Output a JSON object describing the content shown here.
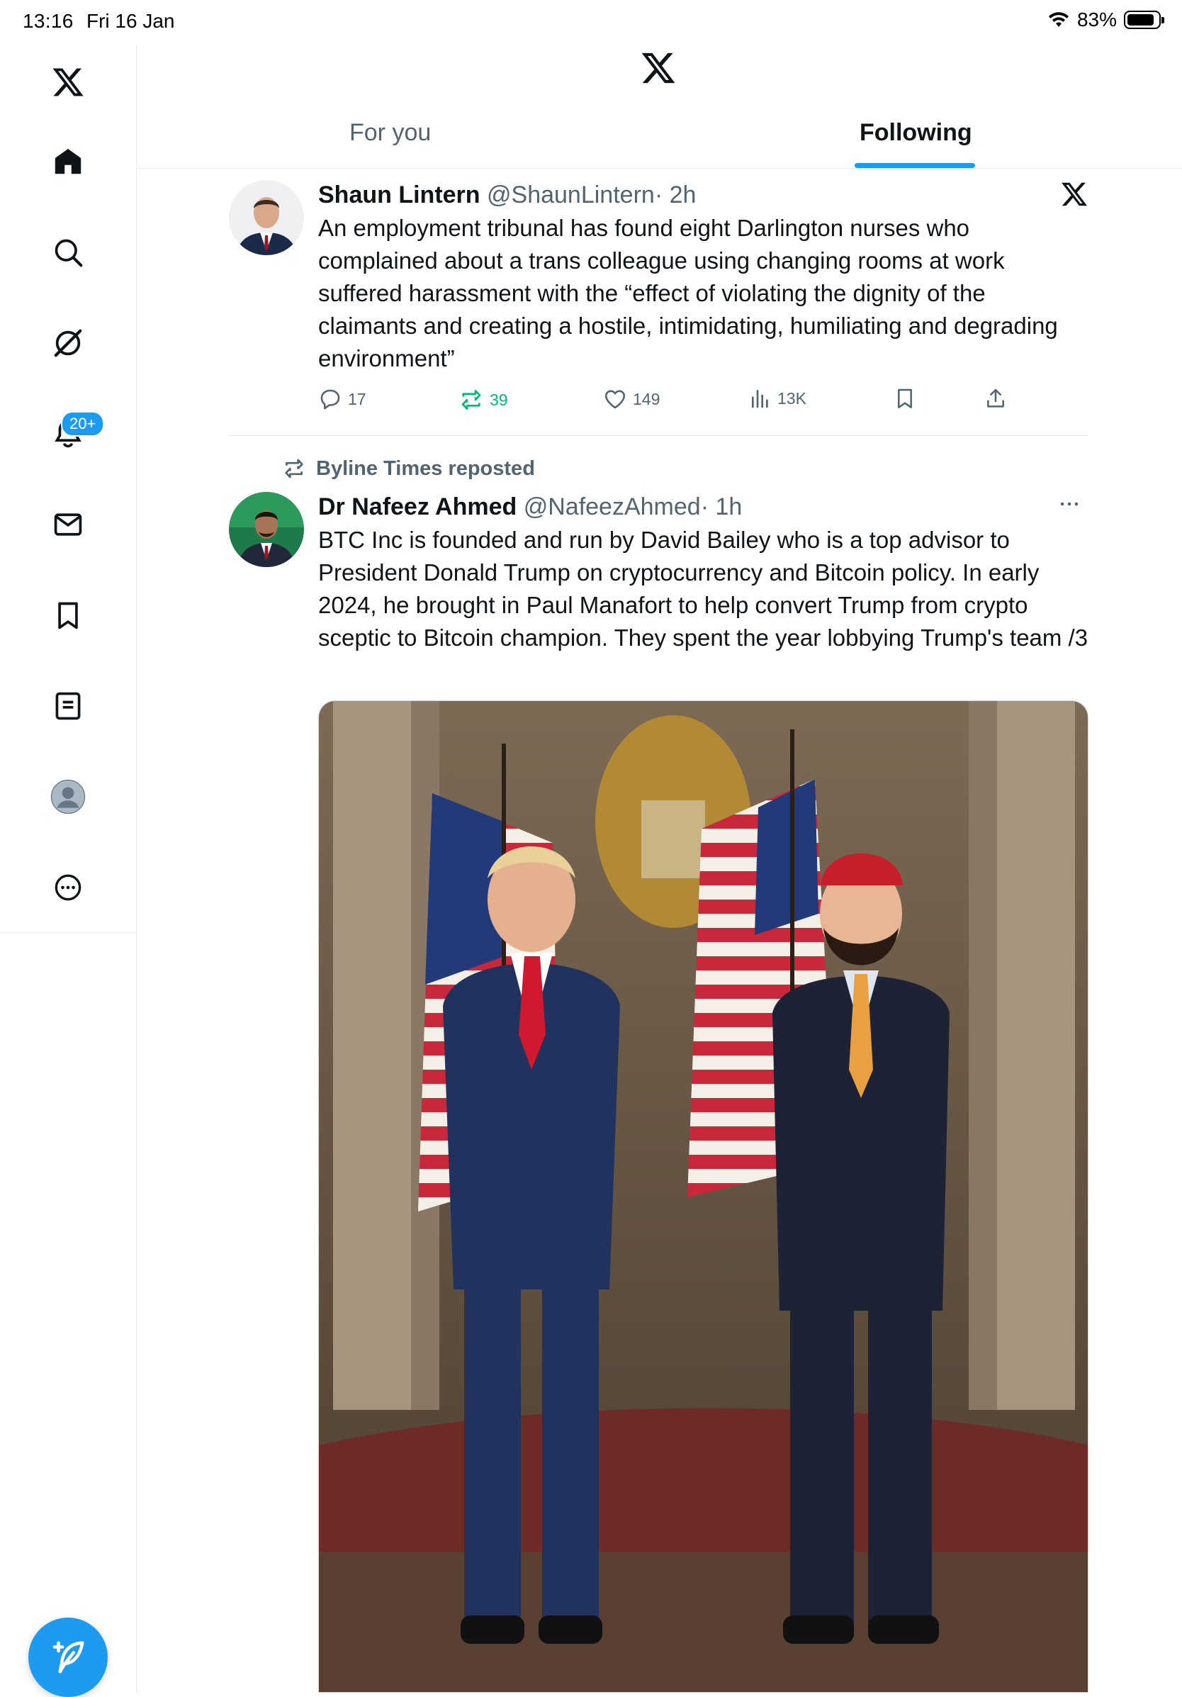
{
  "status_bar": {
    "time": "13:16",
    "date": "Fri 16 Jan",
    "battery": "83%"
  },
  "sidebar": {
    "items": [
      "home-icon",
      "search-icon",
      "grok-icon",
      "notifications-icon",
      "messages-icon",
      "bookmarks-icon",
      "lists-icon",
      "profile-icon",
      "more-icon"
    ],
    "notifications_badge": "20+"
  },
  "header": {
    "tabs": [
      {
        "label": "For you",
        "active": false
      },
      {
        "label": "Following",
        "active": true
      }
    ]
  },
  "tweets": [
    {
      "name": "Shaun Lintern",
      "handle": "@ShaunLintern",
      "time": "· 2h",
      "text": "An employment tribunal has found eight Darlington nurses who complained about a trans colleague using changing rooms at work suffered harassment with the “effect of violating the dignity of the claimants and creating a hostile, intimidating, humiliating and degrading environment”",
      "replies": "17",
      "reposts": "39",
      "likes": "149",
      "views": "13K"
    },
    {
      "repost_label": "Byline Times reposted",
      "name": "Dr Nafeez Ahmed",
      "handle": "@NafeezAhmed",
      "time": "· 1h",
      "text": "BTC Inc is founded and run by David Bailey who is a top advisor to President Donald Trump on cryptocurrency and Bitcoin policy. In early 2024, he brought in Paul Manafort to help convert Trump from crypto sceptic to Bitcoin champion. They spent the year lobbying Trump's team /3"
    }
  ],
  "colors": {
    "accent": "#1d9bf0",
    "repost_green": "#00ba7c",
    "secondary_text": "#536471",
    "divider": "#e7e9ea"
  }
}
